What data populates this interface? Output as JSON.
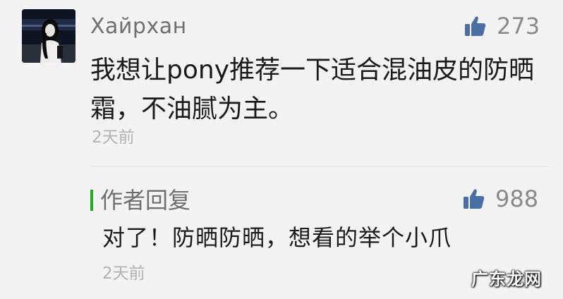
{
  "comment": {
    "username": "Хайрхан",
    "likes": "273",
    "text": "我想让pony推荐一下适合混油皮的防晒霜，不油腻为主。",
    "time": "2天前",
    "avatar_icon": "user-avatar-photo",
    "like_icon": "thumbs-up-icon"
  },
  "reply": {
    "label": "作者回复",
    "likes": "988",
    "text": "对了！防晒防晒，想看的举个小爪",
    "time": "2天前",
    "accent_color": "#1aad19"
  },
  "watermark": {
    "text": "广东龙网"
  }
}
